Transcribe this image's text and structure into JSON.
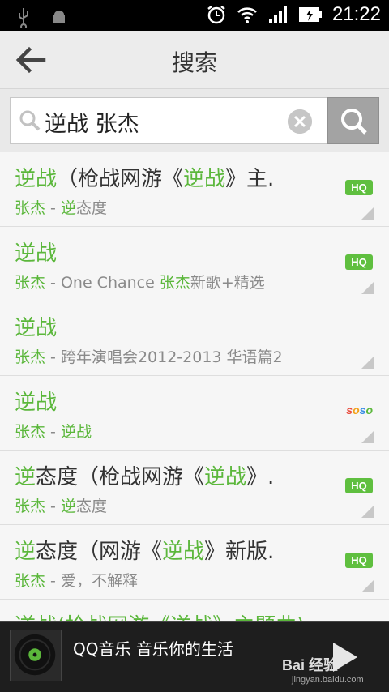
{
  "status_bar": {
    "time": "21:22",
    "icons": [
      "usb-icon",
      "android-debug-icon",
      "alarm-icon",
      "wifi-icon",
      "signal-icon",
      "battery-charging-icon"
    ]
  },
  "header": {
    "title": "搜索",
    "back_icon": "back-arrow-icon"
  },
  "search": {
    "value": "逆战 张杰",
    "search_icon": "search-icon",
    "clear_icon": "clear-icon"
  },
  "results": [
    {
      "title_hl": "逆战",
      "title_rest": "（枪战网游《",
      "title_hl2": "逆战",
      "title_rest2": "》主.",
      "artist": "张杰",
      "sep": " - ",
      "sub_hl": "逆",
      "sub_rest": "态度",
      "badge": "HQ"
    },
    {
      "title_hl": "逆战",
      "title_rest": "",
      "title_hl2": "",
      "title_rest2": "",
      "artist": "张杰",
      "sep": " - ",
      "sub_hl": "",
      "sub_rest": "One  Chance  ",
      "sub_hl2": "张杰",
      "sub_rest2": "新歌+精选",
      "badge": "HQ"
    },
    {
      "title_hl": "逆战",
      "title_rest": "",
      "title_hl2": "",
      "title_rest2": "",
      "artist": "张杰",
      "sep": " - ",
      "sub_hl": "",
      "sub_rest": "跨年演唱会2012-2013  华语篇2",
      "badge": ""
    },
    {
      "title_hl": "逆战",
      "title_rest": "",
      "title_hl2": "",
      "title_rest2": "",
      "artist": "张杰",
      "sep": " - ",
      "sub_hl": "逆战",
      "sub_rest": "",
      "badge": "soso"
    },
    {
      "title_hl": "逆",
      "title_rest": "态度（枪战网游《",
      "title_hl2": "逆战",
      "title_rest2": "》.",
      "artist": "张杰",
      "sep": " - ",
      "sub_hl": "逆",
      "sub_rest": "态度",
      "badge": "HQ"
    },
    {
      "title_hl": "逆",
      "title_rest": "态度（网游《",
      "title_hl2": "逆战",
      "title_rest2": "》新版.",
      "artist": "张杰",
      "sep": " - ",
      "sub_hl": "",
      "sub_rest": "爱，不解释",
      "badge": "HQ"
    }
  ],
  "partial_row": {
    "title": "逆战(枪战网游《逆战》主题曲)"
  },
  "player": {
    "text": "QQ音乐 音乐你的生活",
    "play_icon": "play-icon"
  },
  "watermark": {
    "logo": "Bai 经验",
    "url": "jingyan.baidu.com"
  },
  "colors": {
    "accent_green": "#5bb73b",
    "badge_green": "#5fbf3f"
  }
}
